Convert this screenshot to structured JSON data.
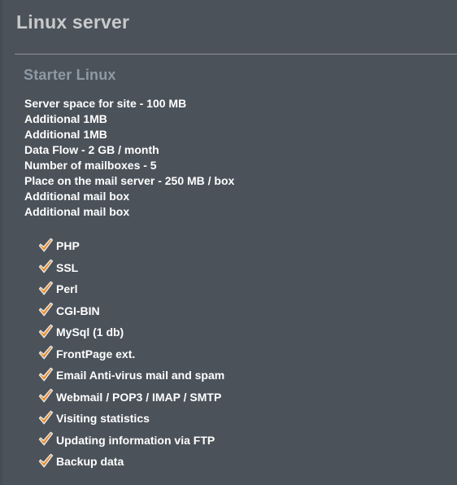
{
  "panel": {
    "title": "Linux server",
    "plan_name": "Starter Linux",
    "background_color": "#4b525a",
    "title_color": "#c8cacb",
    "plan_name_color": "#8d99a4",
    "divider_color": "#8d9197",
    "text_color": "#ffffff",
    "check_color": "#f0891c",
    "check_outline_color": "#e4e6e8"
  },
  "specs": [
    {
      "text": "Server space for site - 100 MB"
    },
    {
      "text": "Additional 1MB"
    },
    {
      "text": "Additional 1MB"
    },
    {
      "text": "Data Flow - 2 GB / month"
    },
    {
      "text": "Number of mailboxes - 5"
    },
    {
      "text": "Place on the mail server - 250 MB / box"
    },
    {
      "text": "Additional mail box"
    },
    {
      "text": "Additional mail box"
    }
  ],
  "features": [
    {
      "icon": "check-icon",
      "label": "PHP"
    },
    {
      "icon": "check-icon",
      "label": "SSL"
    },
    {
      "icon": "check-icon",
      "label": "Perl"
    },
    {
      "icon": "check-icon",
      "label": "CGI-BIN"
    },
    {
      "icon": "check-icon",
      "label": "MySql (1 db)"
    },
    {
      "icon": "check-icon",
      "label": "FrontPage ext."
    },
    {
      "icon": "check-icon",
      "label": "Email Anti-virus mail and spam"
    },
    {
      "icon": "check-icon",
      "label": "Webmail / POP3 / IMAP / SMTP"
    },
    {
      "icon": "check-icon",
      "label": "Visiting statistics"
    },
    {
      "icon": "check-icon",
      "label": "Updating information via FTP"
    },
    {
      "icon": "check-icon",
      "label": "Backup data"
    }
  ]
}
